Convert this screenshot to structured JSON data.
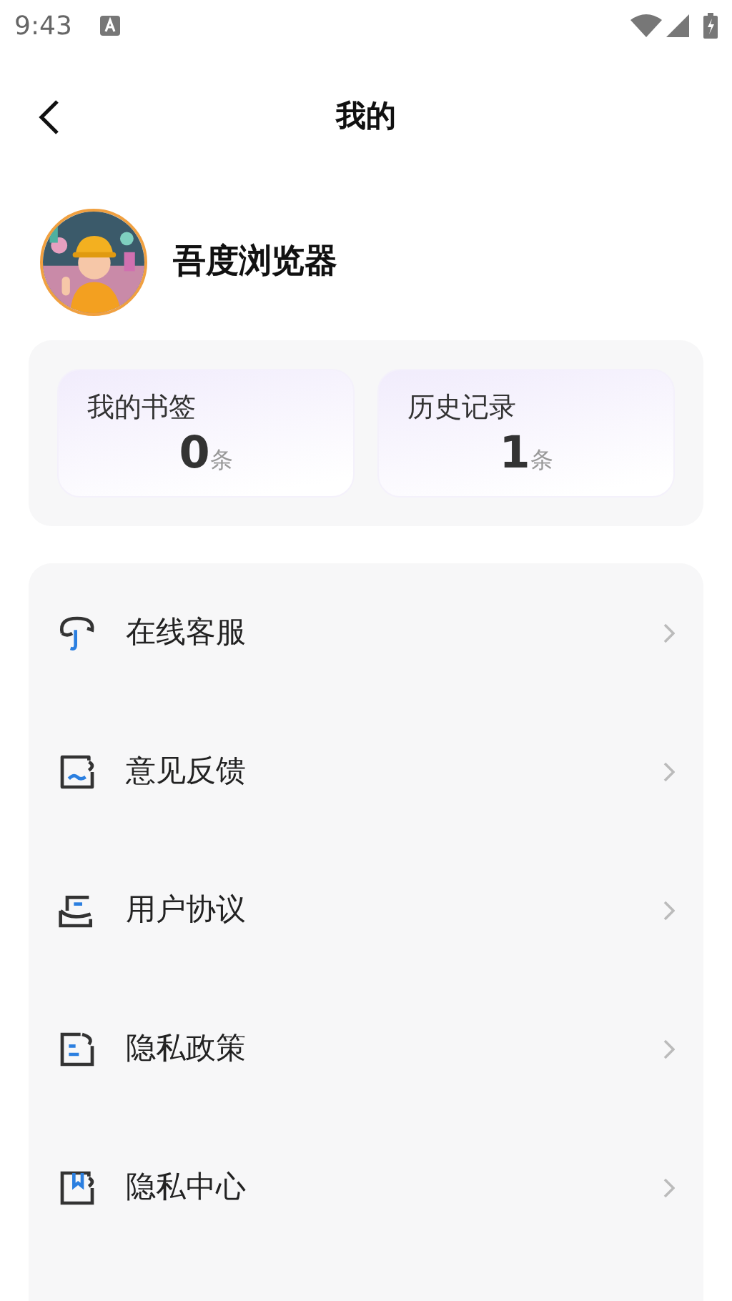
{
  "status_bar": {
    "time": "9:43"
  },
  "header": {
    "title": "我的"
  },
  "profile": {
    "name": "吾度浏览器"
  },
  "stats": [
    {
      "label": "我的书签",
      "value": "0",
      "unit": "条"
    },
    {
      "label": "历史记录",
      "value": "1",
      "unit": "条"
    }
  ],
  "menu": [
    {
      "label": "在线客服"
    },
    {
      "label": "意见反馈"
    },
    {
      "label": "用户协议"
    },
    {
      "label": "隐私政策"
    },
    {
      "label": "隐私中心"
    }
  ]
}
